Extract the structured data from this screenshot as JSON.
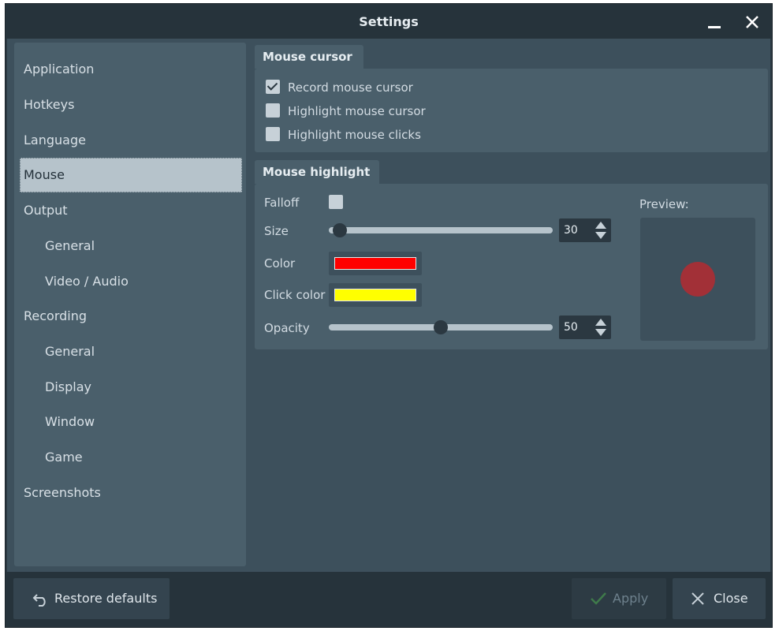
{
  "window": {
    "title": "Settings"
  },
  "sidebar": {
    "items": [
      {
        "label": "Application"
      },
      {
        "label": "Hotkeys"
      },
      {
        "label": "Language"
      },
      {
        "label": "Mouse"
      },
      {
        "label": "Output"
      },
      {
        "label": "General"
      },
      {
        "label": "Video / Audio"
      },
      {
        "label": "Recording"
      },
      {
        "label": "General"
      },
      {
        "label": "Display"
      },
      {
        "label": "Window"
      },
      {
        "label": "Game"
      },
      {
        "label": "Screenshots"
      }
    ],
    "selected": "Mouse"
  },
  "mouse_cursor": {
    "title": "Mouse cursor",
    "options": [
      {
        "label": "Record mouse cursor",
        "checked": true
      },
      {
        "label": "Highlight mouse cursor",
        "checked": false
      },
      {
        "label": "Highlight mouse clicks",
        "checked": false
      }
    ]
  },
  "mouse_highlight": {
    "title": "Mouse highlight",
    "falloff_label": "Falloff",
    "falloff_checked": false,
    "size_label": "Size",
    "size_value": "30",
    "size_fraction": 0.05,
    "color_label": "Color",
    "color_value": "#ff0000",
    "click_color_label": "Click color",
    "click_color_value": "#ffff00",
    "opacity_label": "Opacity",
    "opacity_value": "50",
    "opacity_fraction": 0.5,
    "preview_label": "Preview:"
  },
  "footer": {
    "restore_label": "Restore defaults",
    "apply_label": "Apply",
    "close_label": "Close"
  },
  "colors": {
    "accent_selected": "#b6c3cb",
    "preview_dot": "#b42a30"
  }
}
